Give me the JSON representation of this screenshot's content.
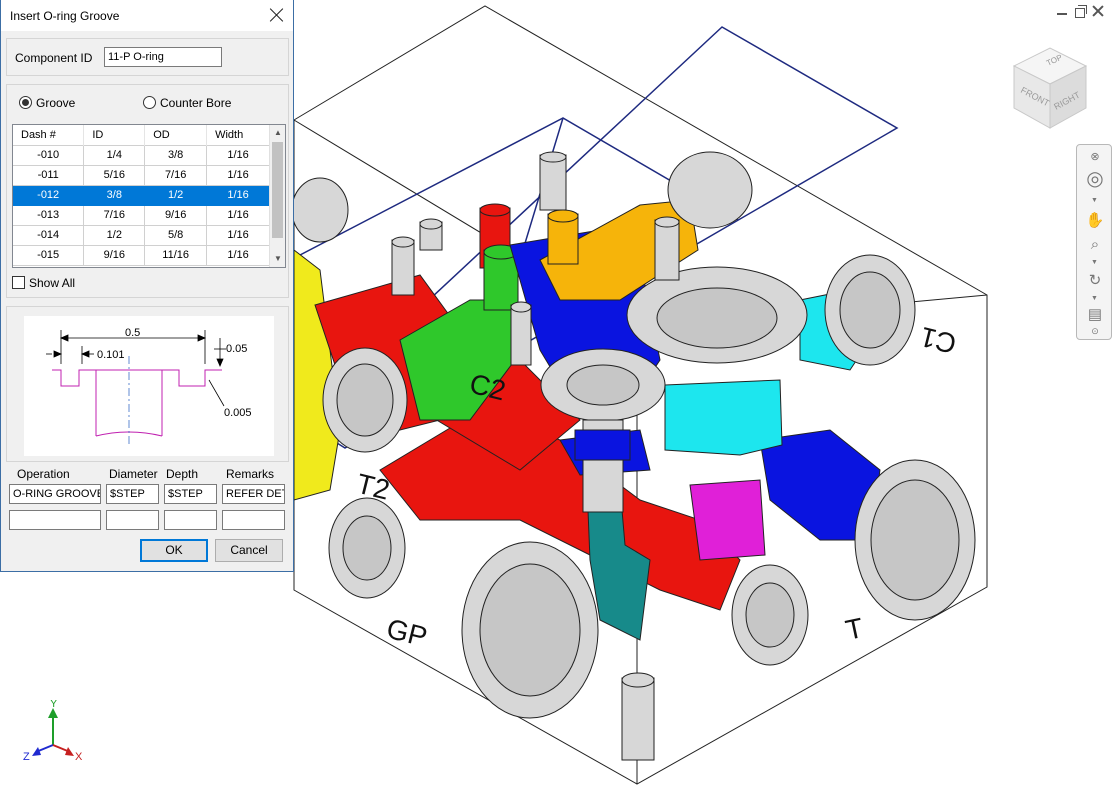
{
  "dialog": {
    "title": "Insert O-ring Groove",
    "component_id_label": "Component ID",
    "component_id_value": "11-P O-ring",
    "radio_groove": "Groove",
    "radio_counter_bore": "Counter Bore",
    "selected_radio": "Groove",
    "table": {
      "columns": [
        "Dash #",
        "ID",
        "OD",
        "Width"
      ],
      "rows": [
        {
          "dash": "-010",
          "id": "1/4",
          "od": "3/8",
          "width": "1/16"
        },
        {
          "dash": "-011",
          "id": "5/16",
          "od": "7/16",
          "width": "1/16"
        },
        {
          "dash": "-012",
          "id": "3/8",
          "od": "1/2",
          "width": "1/16"
        },
        {
          "dash": "-013",
          "id": "7/16",
          "od": "9/16",
          "width": "1/16"
        },
        {
          "dash": "-014",
          "id": "1/2",
          "od": "5/8",
          "width": "1/16"
        },
        {
          "dash": "-015",
          "id": "9/16",
          "od": "11/16",
          "width": "1/16"
        }
      ],
      "selected_row": 2
    },
    "show_all_label": "Show All",
    "show_all_checked": false,
    "figure": {
      "dim_outer": "0.5",
      "dim_inner": "0.101",
      "dim_depth": "0.05",
      "dim_radius": "0.005"
    },
    "fields": {
      "operation_label": "Operation",
      "diameter_label": "Diameter",
      "depth_label": "Depth",
      "remarks_label": "Remarks",
      "operation_value": "O-RING GROOVE",
      "diameter_value": "$STEP",
      "depth_value": "$STEP",
      "remarks_value": "REFER DET",
      "operation_value2": "",
      "diameter_value2": "",
      "depth_value2": "",
      "remarks_value2": ""
    },
    "ok_label": "OK",
    "cancel_label": "Cancel"
  },
  "viewport": {
    "port_labels": [
      "T2",
      "C2",
      "GP",
      "T",
      "C1"
    ],
    "view_cube_faces": {
      "top": "TOP",
      "front": "FRONT",
      "right": "RIGHT"
    },
    "axis_labels": {
      "x": "X",
      "y": "Y",
      "z": "Z"
    },
    "colors": {
      "red": "#e8150f",
      "green": "#2fc82b",
      "blue": "#0a14e0",
      "yellow": "#f0ea1c",
      "orange": "#f6b40a",
      "cyan": "#1de6ee",
      "magenta": "#e020d8",
      "teal": "#178a8a",
      "gray": "#d7d7d7",
      "outline": "#000000"
    }
  }
}
